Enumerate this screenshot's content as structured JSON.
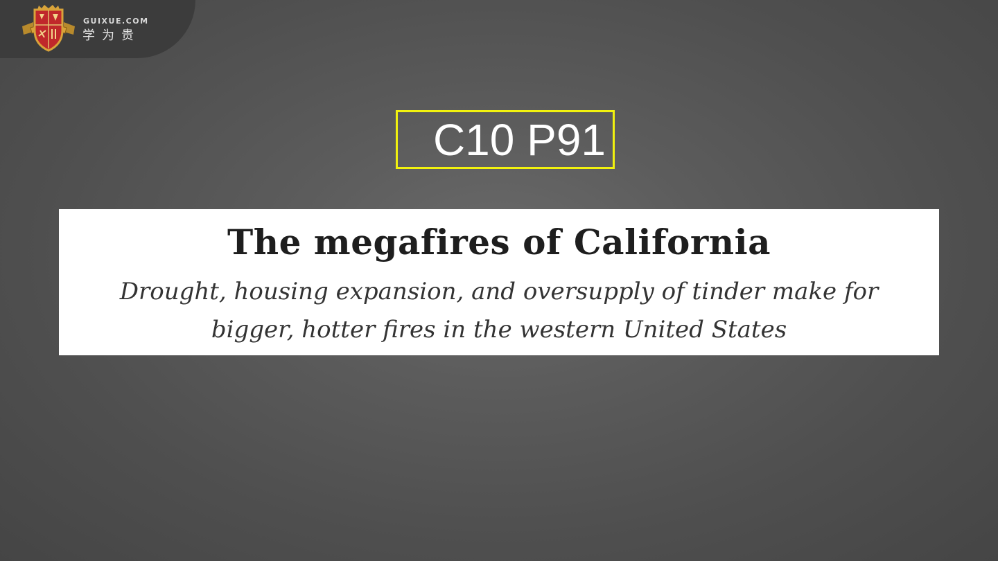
{
  "brand": {
    "domain": "GUIXUE.COM",
    "name": "学为贵",
    "crest_icon": "shield-crest-icon",
    "colors": {
      "crest_red": "#c0282b",
      "crest_gold": "#d8a33a"
    }
  },
  "page_code": {
    "label": "C10 P91",
    "border_color": "#f2f20e"
  },
  "headline": {
    "title": "The megafires of California",
    "subtitle_lines": [
      "Drought, housing expansion, and oversupply of tinder make for",
      "bigger, hotter fires in the western United States"
    ]
  }
}
